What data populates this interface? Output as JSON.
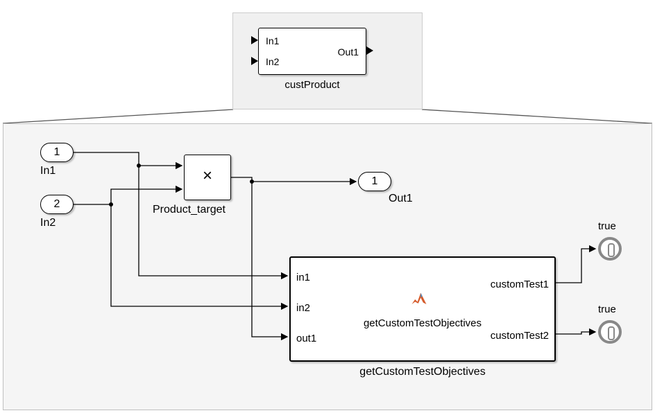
{
  "top_block": {
    "in1": "In1",
    "in2": "In2",
    "out1": "Out1",
    "name": "custProduct"
  },
  "detail": {
    "inport1": {
      "num": "1",
      "label": "In1"
    },
    "inport2": {
      "num": "2",
      "label": "In2"
    },
    "product": {
      "symbol": "×",
      "label": "Product_target"
    },
    "outport1": {
      "num": "1",
      "label": "Out1"
    },
    "func_block": {
      "in1": "in1",
      "in2": "in2",
      "out1": "out1",
      "ct1": "customTest1",
      "ct2": "customTest2",
      "inner_text": "getCustomTestObjectives",
      "name": "getCustomTestObjectives"
    },
    "term1_label": "true",
    "term2_label": "true"
  }
}
